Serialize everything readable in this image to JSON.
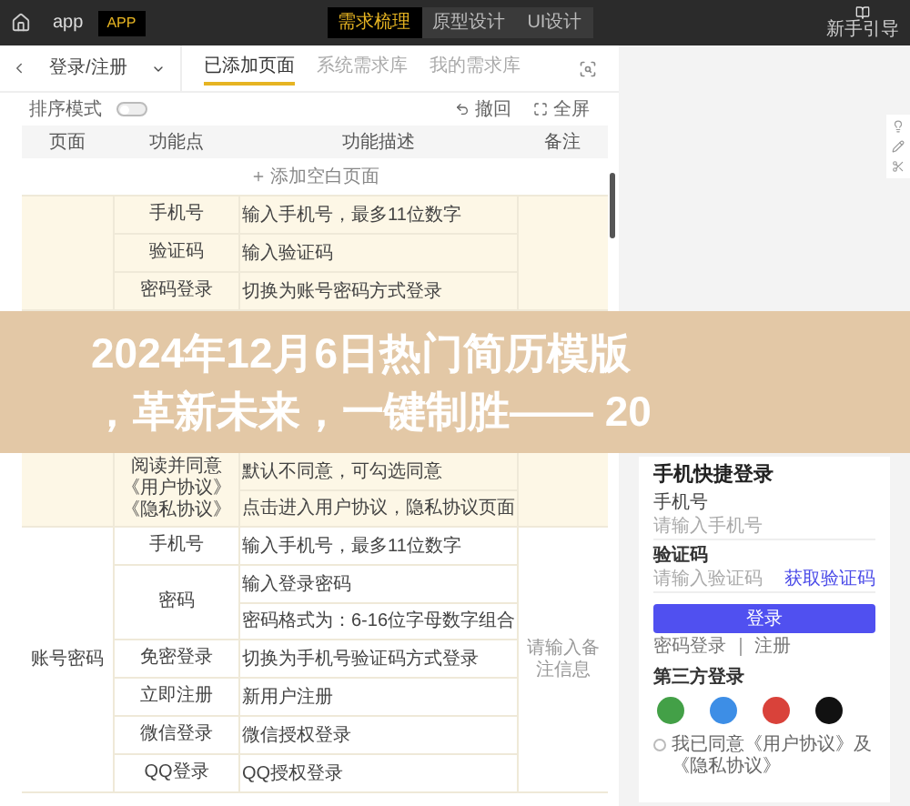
{
  "topbar": {
    "app_name": "app",
    "badge": "APP",
    "tabs": [
      {
        "label": "需求梳理",
        "selected": true
      },
      {
        "label": "原型设计",
        "selected": false
      },
      {
        "label": "UI设计",
        "selected": false
      }
    ],
    "guide": "新手引导"
  },
  "subbar": {
    "page_select": "登录/注册",
    "tabs": [
      {
        "label": "已添加页面",
        "selected": true
      },
      {
        "label": "系统需求库",
        "selected": false
      },
      {
        "label": "我的需求库",
        "selected": false
      }
    ]
  },
  "toolbar": {
    "sort_label": "排序模式",
    "sort_on": false,
    "undo": "撤回",
    "fullscreen": "全屏"
  },
  "table": {
    "columns": [
      "页面",
      "功能点",
      "功能描述",
      "备注"
    ],
    "add_row": "添加空白页面",
    "groups": [
      {
        "highlighted": true,
        "features": [
          {
            "name": "手机号",
            "descriptions": [
              "输入手机号，最多11位数字"
            ]
          },
          {
            "name": "验证码",
            "descriptions": [
              "输入验证码"
            ]
          },
          {
            "name": "密码登录",
            "descriptions": [
              "切换为账号密码方式登录"
            ]
          }
        ]
      }
    ]
  },
  "banner": {
    "lines": [
      "2024年12月6日热门简历模版",
      "，革新未来，一键制胜—— 20"
    ]
  },
  "table_continued": {
    "groups": [
      {
        "highlighted": true,
        "features": [
          {
            "name": "阅读并同意《用户协议》《隐私协议》",
            "descriptions": [
              "默认不同意，可勾选同意",
              "点击进入用户协议，隐私协议页面"
            ]
          }
        ]
      },
      {
        "page": "账号密码",
        "note_placeholder": "请输入备注信息",
        "highlighted": false,
        "features": [
          {
            "name": "手机号",
            "descriptions": [
              "输入手机号，最多11位数字"
            ]
          },
          {
            "name": "密码",
            "descriptions": [
              "输入登录密码",
              "密码格式为：6-16位字母数字组合"
            ]
          },
          {
            "name": "免密登录",
            "descriptions": [
              "切换为手机号验证码方式登录"
            ]
          },
          {
            "name": "立即注册",
            "descriptions": [
              "新用户注册"
            ]
          },
          {
            "name": "微信登录",
            "descriptions": [
              "微信授权登录"
            ]
          },
          {
            "name": "QQ登录",
            "descriptions": [
              "QQ授权登录"
            ]
          }
        ]
      }
    ]
  },
  "preview": {
    "title": "手机快捷登录",
    "phone_label": "手机号",
    "phone_placeholder": "请输入手机号",
    "code_label": "验证码",
    "code_placeholder": "请输入验证码",
    "get_code": "获取验证码",
    "login_button": "登录",
    "links": "密码登录 ｜ 注册",
    "third_party": "第三方登录",
    "socials": [
      {
        "color": "#43a047"
      },
      {
        "color": "#3d8ee6"
      },
      {
        "color": "#d9423a"
      },
      {
        "color": "#111111"
      }
    ],
    "agree_checked": false,
    "agree": "我已同意《用户协议》及《隐私协议》"
  }
}
